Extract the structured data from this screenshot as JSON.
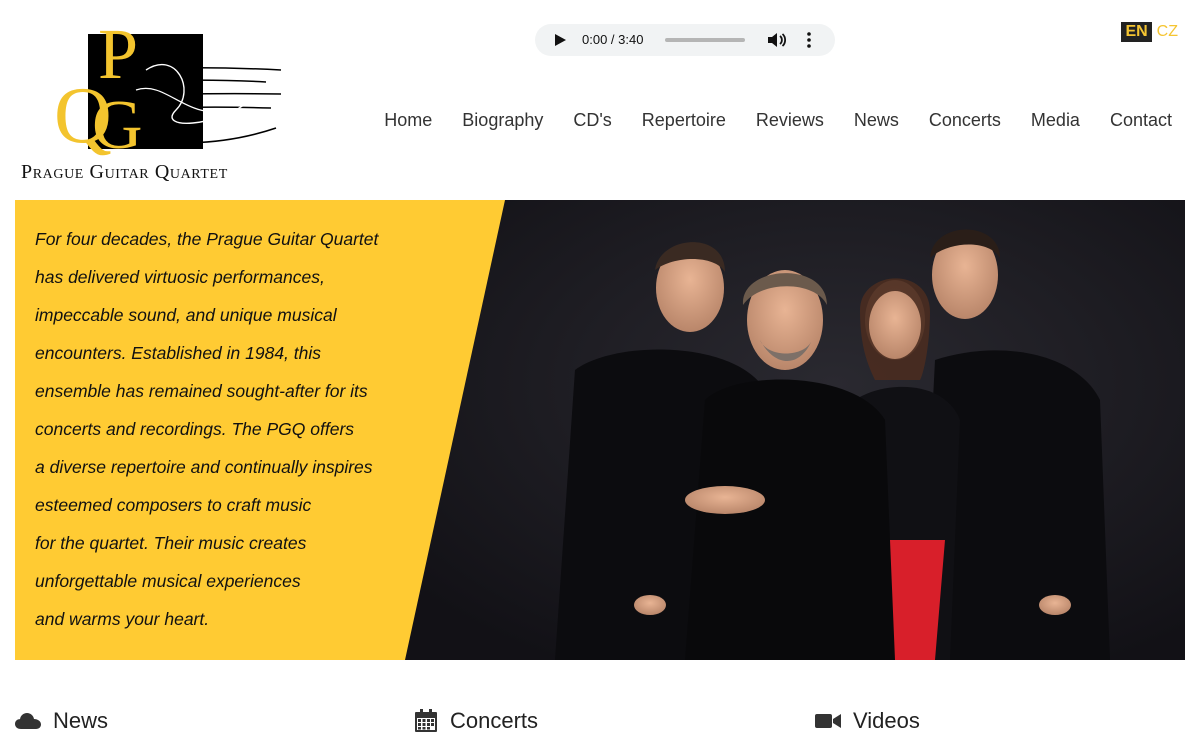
{
  "brand": {
    "name": "Prague Guitar Quartet",
    "logo_letters": "PGQ"
  },
  "audio": {
    "time": "0:00 / 3:40",
    "progress": 0
  },
  "languages": {
    "active": "EN",
    "other": "CZ"
  },
  "nav": [
    {
      "label": "Home"
    },
    {
      "label": "Biography"
    },
    {
      "label": "CD's"
    },
    {
      "label": "Repertoire"
    },
    {
      "label": "Reviews"
    },
    {
      "label": "News"
    },
    {
      "label": "Concerts"
    },
    {
      "label": "Media"
    },
    {
      "label": "Contact"
    }
  ],
  "hero": {
    "lines": [
      "For four decades, the Prague Guitar Quartet",
      "has delivered virtuosic performances,",
      "impeccable sound, and unique musical",
      "encounters. Established in 1984, this",
      "ensemble has remained sought-after for its",
      "concerts and recordings. The PGQ offers",
      "a diverse repertoire and continually inspires",
      "esteemed composers to craft music",
      "for the quartet. Their music creates",
      "unforgettable musical experiences",
      "and warms your heart."
    ],
    "colors": {
      "accent": "#ffcb33",
      "photo_bg": "#1b1a1f",
      "dress": "#d81f2a"
    }
  },
  "sections": {
    "news": {
      "title": "News",
      "icon": "cloud-icon"
    },
    "concerts": {
      "title": "Concerts",
      "icon": "calendar-icon"
    },
    "videos": {
      "title": "Videos",
      "icon": "video-camera-icon"
    }
  }
}
